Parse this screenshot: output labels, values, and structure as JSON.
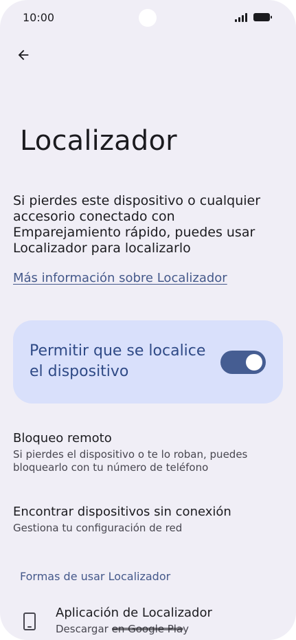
{
  "status_bar": {
    "time": "10:00"
  },
  "header": {
    "title": "Localizador"
  },
  "main": {
    "description": "Si pierdes este dispositivo o cualquier accesorio conectado con Emparejamiento rápido, puedes usar Localizador para localizarlo",
    "learn_more": "Más información sobre Localizador",
    "toggle": {
      "label": "Permitir que se localice el dispositivo",
      "state": "on"
    },
    "settings": [
      {
        "title": "Bloqueo remoto",
        "subtitle": "Si pierdes el dispositivo o te lo roban, puedes bloquearlo con tu número de teléfono"
      },
      {
        "title": "Encontrar dispositivos sin conexión",
        "subtitle": "Gestiona tu configuración de red"
      }
    ],
    "section_header": "Formas de usar Localizador",
    "app_item": {
      "title": "Aplicación de Localizador",
      "subtitle": "Descargar en Google Play",
      "icon": "phone-icon"
    }
  },
  "colors": {
    "background": "#f0eef6",
    "card": "#d9e0fb",
    "accent": "#44588a",
    "switch": "#455d92"
  }
}
